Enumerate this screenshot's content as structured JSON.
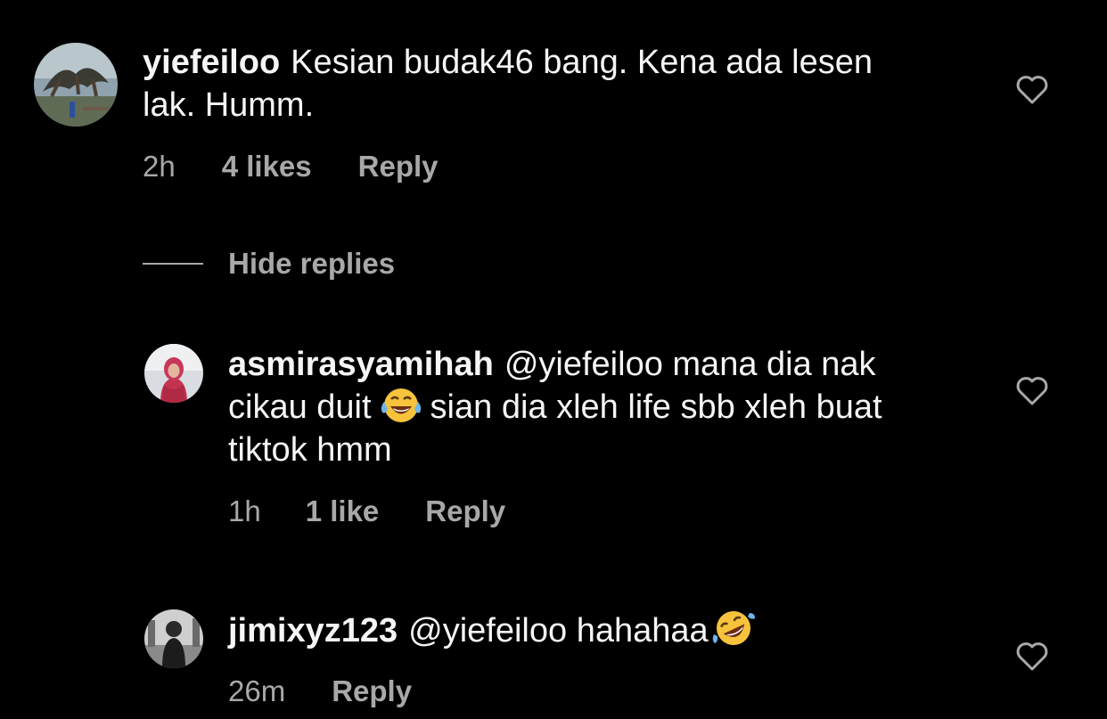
{
  "comments": [
    {
      "username": "yiefeiloo",
      "text": "Kesian budak46 bang. Kena ada lesen lak. Humm.",
      "time": "2h",
      "likes": "4 likes",
      "reply_label": "Reply",
      "like_icon": "heart-outline-icon"
    }
  ],
  "hide_replies_label": "Hide replies",
  "replies": [
    {
      "username": "asmirasyamihah",
      "mention": "@yiefeiloo",
      "text_before_emoji": "mana dia nak cikau duit",
      "emoji": "face-with-tears-of-joy",
      "text_after_emoji": "sian dia xleh life sbb xleh buat tiktok hmm",
      "time": "1h",
      "likes": "1 like",
      "reply_label": "Reply",
      "like_icon": "heart-outline-icon"
    },
    {
      "username": "jimixyz123",
      "mention": "@yiefeiloo",
      "text": "hahahaa",
      "emoji": "rolling-on-the-floor-laughing",
      "time": "26m",
      "reply_label": "Reply",
      "like_icon": "heart-outline-icon"
    }
  ],
  "colors": {
    "background": "#000000",
    "primary_text": "#f5f5f5",
    "secondary_text": "#a8a8a8",
    "emoji_yellow": "#f7c33c"
  }
}
